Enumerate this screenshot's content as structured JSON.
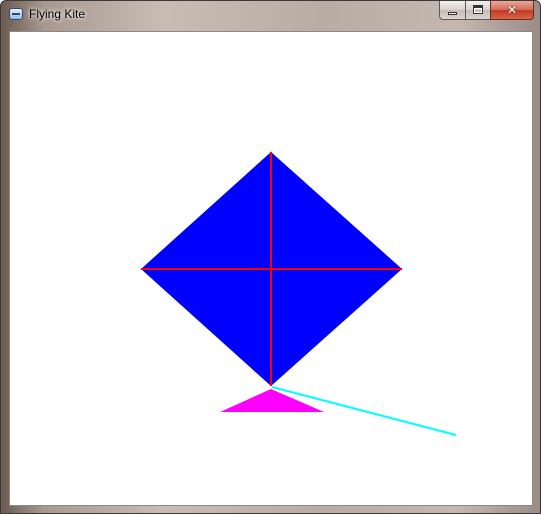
{
  "window": {
    "title": "Flying Kite"
  },
  "caption_buttons": {
    "minimize": "minimize",
    "maximize": "maximize",
    "close": "close"
  },
  "icons": {
    "app": "app-window-icon",
    "minimize": "minimize-icon",
    "maximize": "maximize-icon",
    "close": "close-icon"
  },
  "colors": {
    "kite_body": "#0000ff",
    "kite_spars": "#ff0000",
    "kite_tail": "#ff00ff",
    "kite_string": "#00ffff",
    "canvas_background": "#ffffff"
  }
}
